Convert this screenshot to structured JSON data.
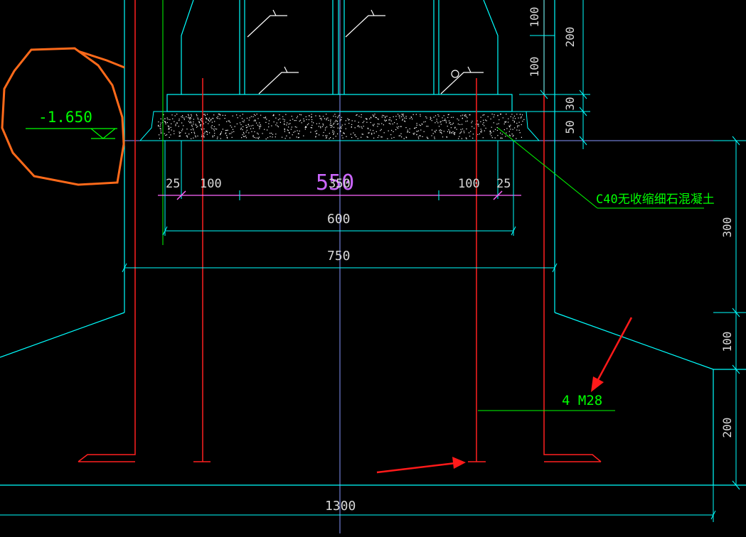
{
  "colors": {
    "background": "#000000",
    "cyan": "#00ffff",
    "red": "#ff2020",
    "green": "#00ff00",
    "blue_grey": "#8899ff",
    "magenta": "#ff66ff",
    "white": "#ffffff",
    "orange": "#ff6a1a",
    "dim_text": "#d8d8d8"
  },
  "elevation": {
    "label": "-1.650"
  },
  "annotations": {
    "grout_note": "C40无收缩细石混凝土",
    "bolt_note": "4 M28"
  },
  "dimensions": {
    "top_left_25": "25",
    "top_left_100": "100",
    "center_550": "550",
    "center_350": "350",
    "top_right_100": "100",
    "top_right_25": "25",
    "width_600": "600",
    "width_750": "750",
    "width_1300": "1300",
    "right_100_top": "100",
    "right_200_top": "200",
    "right_100_mid": "100",
    "right_30": "30",
    "right_50": "50",
    "right_300": "300",
    "right_100_low": "100",
    "right_200_low": "200"
  }
}
